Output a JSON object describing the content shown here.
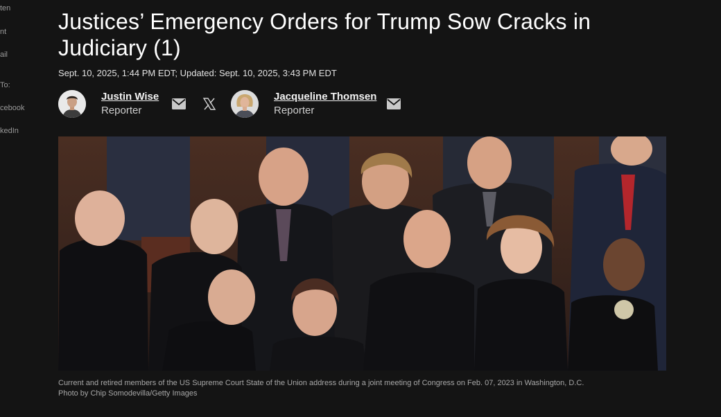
{
  "sidebar": {
    "items": [
      {
        "label": "ten"
      },
      {
        "label": "nt"
      },
      {
        "label": "ail"
      },
      {
        "label": "To:"
      },
      {
        "label": "cebook"
      },
      {
        "label": "kedIn"
      }
    ]
  },
  "article": {
    "headline": "Justices’ Emergency Orders for Trump Sow Cracks in Judiciary (1)",
    "dateline": "Sept. 10, 2025, 1:44 PM EDT; Updated: Sept. 10, 2025, 3:43 PM EDT"
  },
  "authors": [
    {
      "name": "Justin Wise",
      "role": "Reporter",
      "icons": [
        "email-icon",
        "x-icon"
      ]
    },
    {
      "name": "Jacqueline Thomsen",
      "role": "Reporter",
      "icons": [
        "email-icon"
      ]
    }
  ],
  "photo": {
    "caption": "Current and retired members of the US Supreme Court State of the Union address during a joint meeting of Congress on Feb. 07, 2023 in Washington, D.C.",
    "credit": "Photo by Chip Somodevilla/Getty Images"
  },
  "colors": {
    "background": "#141414",
    "text": "#ffffff",
    "muted": "#a8a8a8"
  }
}
